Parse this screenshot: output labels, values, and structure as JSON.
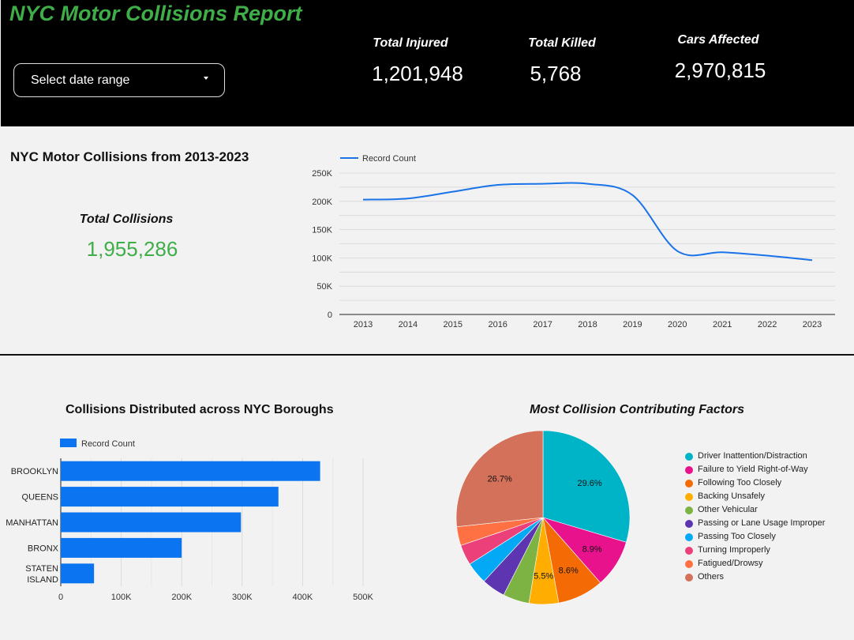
{
  "header": {
    "title": "NYC Motor Collisions Report",
    "date_range_label": "Select date range"
  },
  "kpis": [
    {
      "label": "Total Injured",
      "value": "1,201,948"
    },
    {
      "label": "Total Killed",
      "value": "5,768"
    },
    {
      "label": "Cars Affected",
      "value": "2,970,815"
    }
  ],
  "section_title": "NYC Motor Collisions from 2013-2023",
  "total_collisions": {
    "label": "Total Collisions",
    "value": "1,955,286"
  },
  "colors": {
    "accent_green": "#3fae49",
    "header_bg": "#000000",
    "series_blue": "#1a73e8",
    "bar_blue": "#0b74f0"
  },
  "chart_data": [
    {
      "type": "line",
      "title": "",
      "xlabel": "",
      "ylabel": "",
      "legend": "top-left",
      "grid": true,
      "x": [
        "2013",
        "2014",
        "2015",
        "2016",
        "2017",
        "2018",
        "2019",
        "2020",
        "2021",
        "2022",
        "2023"
      ],
      "series": [
        {
          "name": "Record Count",
          "values": [
            203000,
            205000,
            217000,
            229000,
            231000,
            231000,
            211000,
            112000,
            110000,
            104000,
            96000
          ]
        }
      ],
      "yticks": [
        "0",
        "50K",
        "100K",
        "150K",
        "200K",
        "250K"
      ],
      "ylim": [
        0,
        250000
      ]
    },
    {
      "type": "bar",
      "orientation": "horizontal",
      "title": "Collisions Distributed across NYC Boroughs",
      "legend": "top-left",
      "categories": [
        "BROOKLYN",
        "QUEENS",
        "MANHATTAN",
        "BRONX",
        "STATEN ISLAND"
      ],
      "series": [
        {
          "name": "Record Count",
          "values": [
            429000,
            360000,
            298000,
            200000,
            55000
          ]
        }
      ],
      "xticks": [
        "0",
        "100K",
        "200K",
        "300K",
        "400K",
        "500K"
      ],
      "xlim": [
        0,
        500000
      ],
      "grid": true
    },
    {
      "type": "pie",
      "title": "Most Collision Contributing Factors",
      "legend": "right",
      "slices": [
        {
          "label": "Driver Inattention/Distraction",
          "value": 29.6,
          "color": "#00b4c8",
          "text": "29.6%"
        },
        {
          "label": "Failure to Yield Right-of-Way",
          "value": 8.9,
          "color": "#e8128c",
          "text": "8.9%"
        },
        {
          "label": "Following Too Closely",
          "value": 8.6,
          "color": "#f46b06",
          "text": "8.6%"
        },
        {
          "label": "Backing Unsafely",
          "value": 5.5,
          "color": "#ffad00",
          "text": "5.5%"
        },
        {
          "label": "Other Vehicular",
          "value": 4.9,
          "color": "#7cb342",
          "text": ""
        },
        {
          "label": "Passing or Lane Usage Improper",
          "value": 4.4,
          "color": "#5e35b1",
          "text": ""
        },
        {
          "label": "Passing Too Closely",
          "value": 4.1,
          "color": "#03a9f4",
          "text": ""
        },
        {
          "label": "Turning Improperly",
          "value": 3.8,
          "color": "#ec407a",
          "text": ""
        },
        {
          "label": "Fatigued/Drowsy",
          "value": 3.5,
          "color": "#ff7043",
          "text": ""
        },
        {
          "label": "Others",
          "value": 26.7,
          "color": "#d4715a",
          "text": "26.7%"
        }
      ]
    }
  ]
}
